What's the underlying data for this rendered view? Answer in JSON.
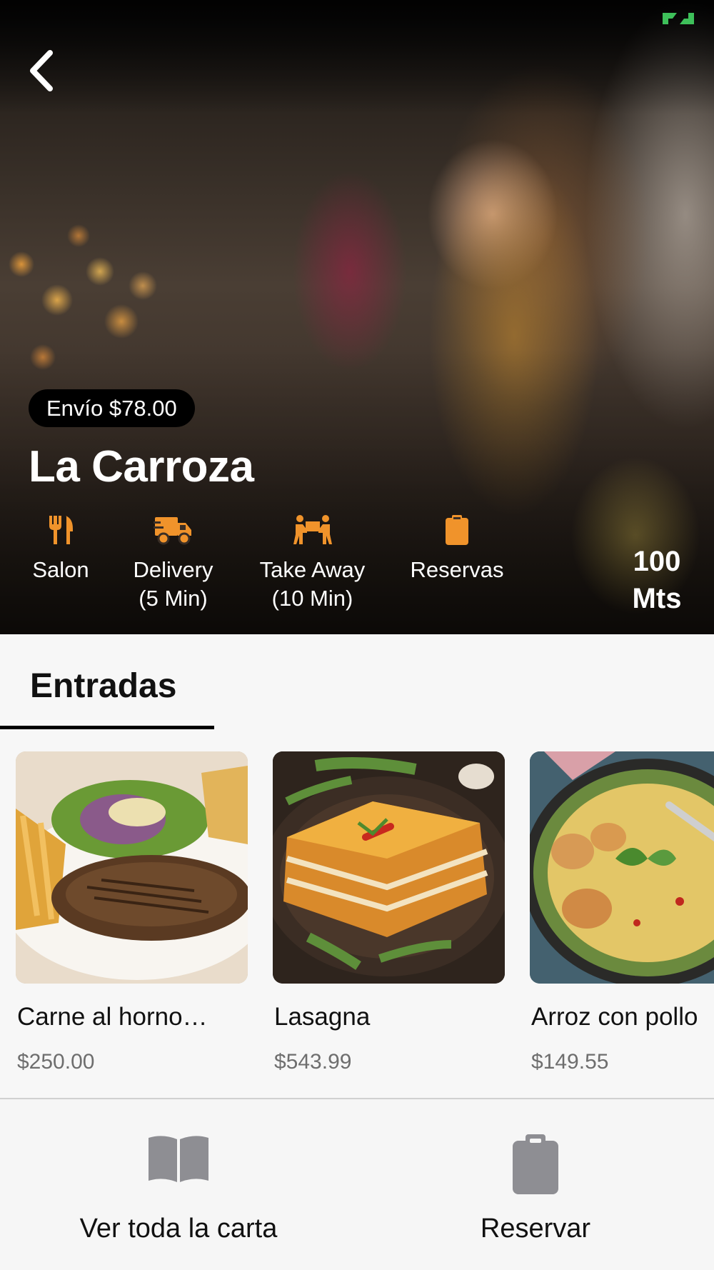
{
  "colors": {
    "accent": "#f0932b",
    "icon_gray": "#8e8e93",
    "battery": "#3ec05a"
  },
  "header": {
    "back_icon": "chevron-left-icon",
    "shipping_badge": "Envío $78.00",
    "restaurant_name": "La Carroza",
    "distance_value": "100",
    "distance_unit": "Mts"
  },
  "services": [
    {
      "icon": "utensils-icon",
      "label": "Salon",
      "sublabel": ""
    },
    {
      "icon": "truck-icon",
      "label": "Delivery",
      "sublabel": "(5 Min)"
    },
    {
      "icon": "people-carry-icon",
      "label": "Take Away",
      "sublabel": "(10 Min)"
    },
    {
      "icon": "clipboard-icon",
      "label": "Reservas",
      "sublabel": ""
    }
  ],
  "category_tab": {
    "label": "Entradas"
  },
  "products": [
    {
      "name": "Carne al horno…",
      "price": "$250.00"
    },
    {
      "name": "Lasagna",
      "price": "$543.99"
    },
    {
      "name": "Arroz con pollo",
      "price": "$149.55"
    }
  ],
  "bottom_bar": {
    "menu": {
      "icon": "book-open-icon",
      "label": "Ver toda la carta"
    },
    "reserve": {
      "icon": "clipboard-icon",
      "label": "Reservar"
    }
  }
}
